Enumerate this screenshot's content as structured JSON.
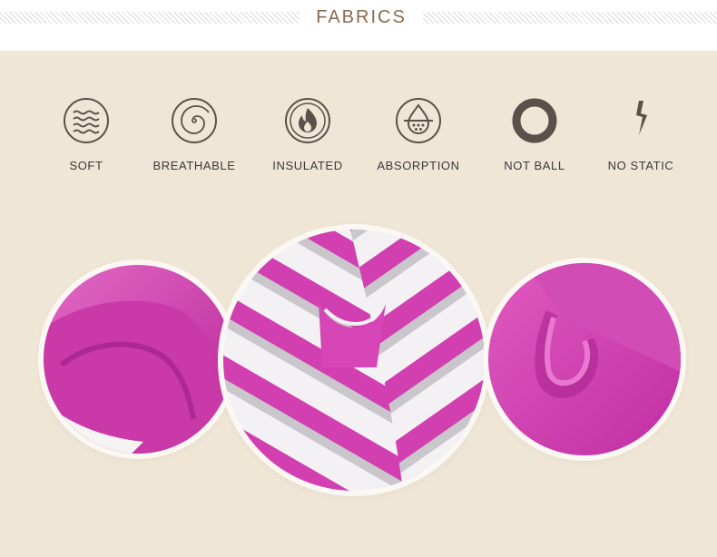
{
  "header": {
    "title": "FABRICS"
  },
  "features": [
    {
      "label": "SOFT",
      "icon": "waves-icon"
    },
    {
      "label": "BREATHABLE",
      "icon": "spiral-icon"
    },
    {
      "label": "INSULATED",
      "icon": "flame-icon"
    },
    {
      "label": "ABSORPTION",
      "icon": "water-drop-icon"
    },
    {
      "label": "NOT BALL",
      "icon": "ring-icon"
    },
    {
      "label": "NO STATIC",
      "icon": "lightning-icon"
    }
  ],
  "colors": {
    "background": "#efe6d6",
    "title": "#8a6a4c",
    "icon": "#5a514a",
    "fabric_pink": "#d23fb0",
    "fabric_white": "#f4f1f4",
    "fabric_gray": "#c9c6cc"
  }
}
